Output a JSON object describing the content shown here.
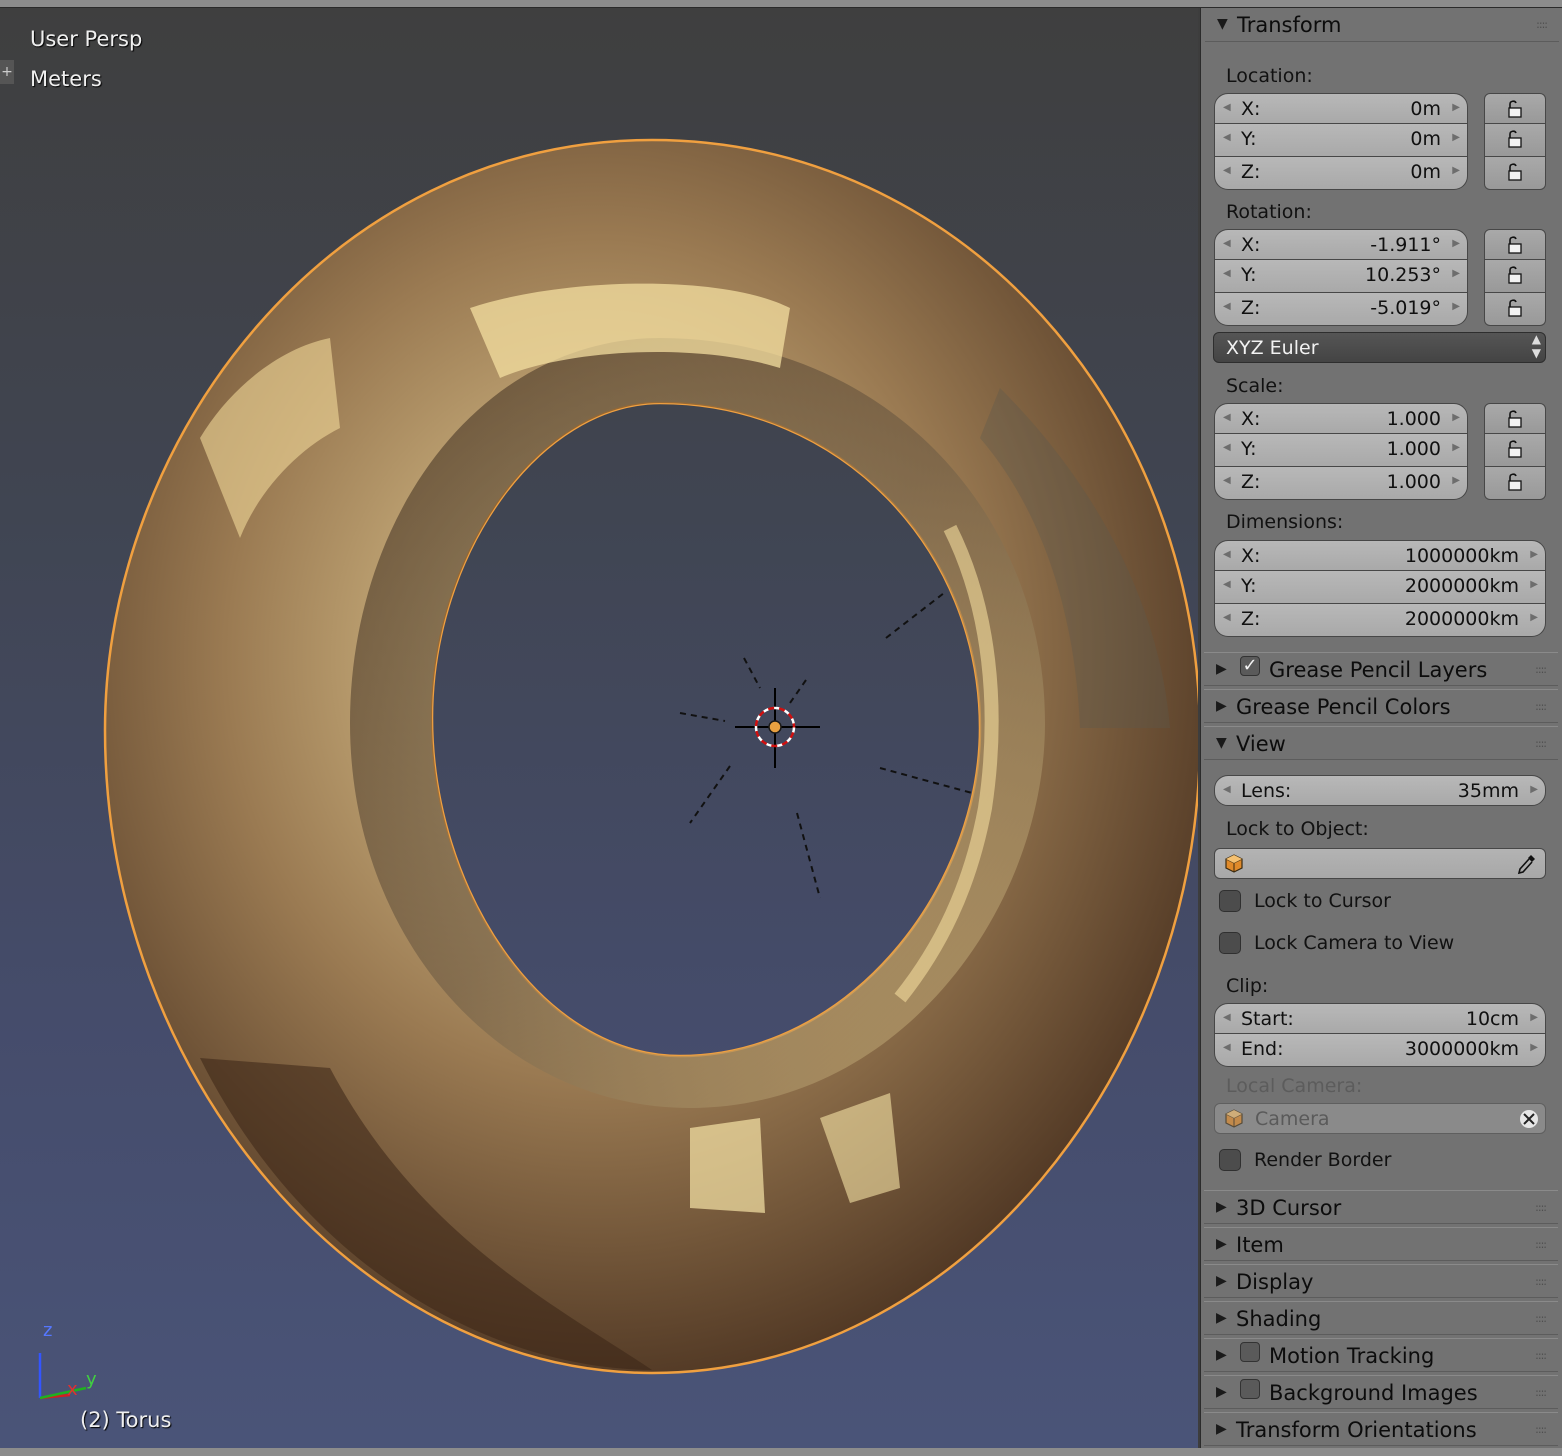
{
  "viewport": {
    "view_name": "User Persp",
    "units": "Meters",
    "object_info": "(2) Torus",
    "axis_z": "z",
    "axis_x": "x",
    "axis_y": "y",
    "plus_icon": "plus-icon"
  },
  "colors": {
    "selection_outline": "#f0a040",
    "viewport_bg_top": "#3f3f3f",
    "viewport_bg_bottom": "#4a5478",
    "panel_bg": "#727272"
  },
  "transform": {
    "title": "Transform",
    "location_label": "Location:",
    "location": [
      {
        "axis": "X:",
        "value": "0m"
      },
      {
        "axis": "Y:",
        "value": "0m"
      },
      {
        "axis": "Z:",
        "value": "0m"
      }
    ],
    "rotation_label": "Rotation:",
    "rotation": [
      {
        "axis": "X:",
        "value": "-1.911°"
      },
      {
        "axis": "Y:",
        "value": "10.253°"
      },
      {
        "axis": "Z:",
        "value": "-5.019°"
      }
    ],
    "rotation_mode": "XYZ Euler",
    "scale_label": "Scale:",
    "scale": [
      {
        "axis": "X:",
        "value": "1.000"
      },
      {
        "axis": "Y:",
        "value": "1.000"
      },
      {
        "axis": "Z:",
        "value": "1.000"
      }
    ],
    "dimensions_label": "Dimensions:",
    "dimensions": [
      {
        "axis": "X:",
        "value": "1000000km"
      },
      {
        "axis": "Y:",
        "value": "2000000km"
      },
      {
        "axis": "Z:",
        "value": "2000000km"
      }
    ]
  },
  "grease_pencil_layers": {
    "title": "Grease Pencil Layers",
    "checked": true
  },
  "grease_pencil_colors": {
    "title": "Grease Pencil Colors"
  },
  "view": {
    "title": "View",
    "lens_label": "Lens:",
    "lens_value": "35mm",
    "lock_object_label": "Lock to Object:",
    "lock_to_cursor": "Lock to Cursor",
    "lock_camera_to_view": "Lock Camera to View",
    "clip_label": "Clip:",
    "clip_start_label": "Start:",
    "clip_start_value": "10cm",
    "clip_end_label": "End:",
    "clip_end_value": "3000000km",
    "local_camera_label": "Local Camera:",
    "local_camera_value": "Camera",
    "render_border": "Render Border"
  },
  "collapsed_panels": [
    {
      "title": "3D Cursor"
    },
    {
      "title": "Item"
    },
    {
      "title": "Display"
    },
    {
      "title": "Shading"
    }
  ],
  "motion_tracking": {
    "title": "Motion Tracking"
  },
  "background_images": {
    "title": "Background Images"
  },
  "transform_orientations": {
    "title": "Transform Orientations"
  }
}
